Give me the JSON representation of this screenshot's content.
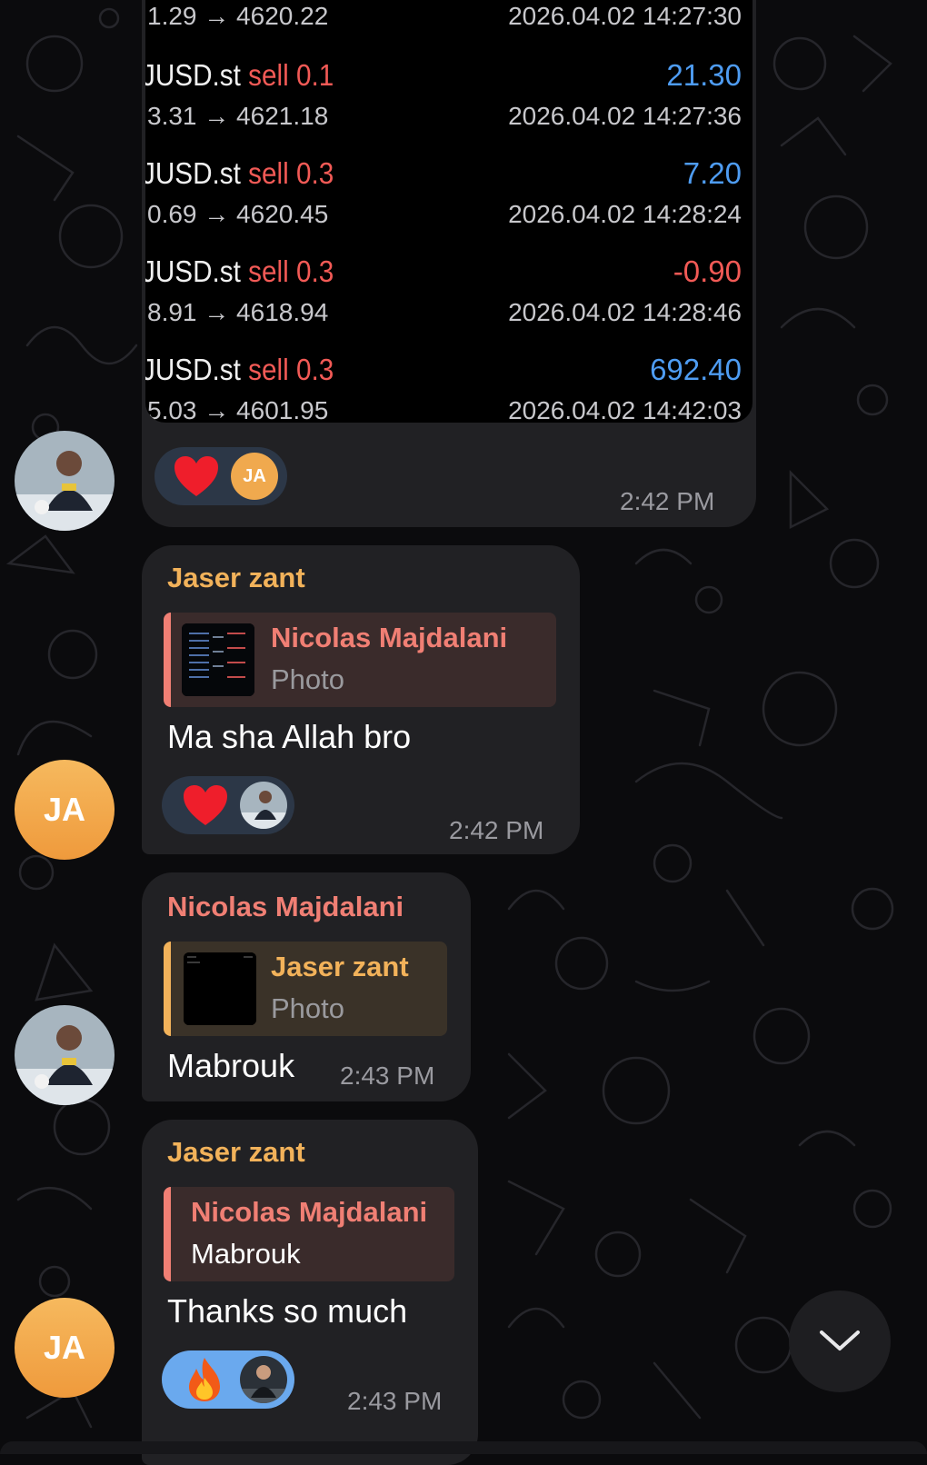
{
  "colors": {
    "profit_positive": "#4e9cf2",
    "profit_negative": "#f25a56",
    "sender_jaser": "#f2b25a",
    "sender_nicolas": "#f07f74",
    "bubble": "#212124",
    "background": "#0b0b0d"
  },
  "trade_screenshot": {
    "first_row": {
      "prices": "1.29 → 4620.22",
      "date": "2026.04.02 14:27:30"
    },
    "rows": [
      {
        "symbol": "JUSD.st",
        "side": "sell 0.1",
        "profit": "21.30",
        "prices": "3.31 → 4621.18",
        "date": "2026.04.02 14:27:36",
        "profit_color": "#4e9cf2"
      },
      {
        "symbol": "JUSD.st",
        "side": "sell 0.3",
        "profit": "7.20",
        "prices": "0.69 → 4620.45",
        "date": "2026.04.02 14:28:24",
        "profit_color": "#4e9cf2"
      },
      {
        "symbol": "JUSD.st",
        "side": "sell 0.3",
        "profit": "-0.90",
        "prices": "8.91 → 4618.94",
        "date": "2026.04.02 14:28:46",
        "profit_color": "#f25a56"
      },
      {
        "symbol": "JUSD.st",
        "side": "sell 0.3",
        "profit": "692.40",
        "prices": "5.03 → 4601.95",
        "date": "2026.04.02 14:42:03",
        "profit_color": "#4e9cf2"
      }
    ]
  },
  "messages": [
    {
      "sender": "",
      "time": "2:42 PM",
      "reaction": {
        "emoji": "heart",
        "reactor_initials": "JA"
      }
    },
    {
      "sender": "Jaser zant",
      "reply": {
        "name": "Nicolas Majdalani",
        "text": "Photo"
      },
      "text": "Ma sha Allah bro",
      "time": "2:42 PM",
      "reaction": {
        "emoji": "heart",
        "reactor_icon": "user-photo-icon"
      },
      "avatar_initials": "JA"
    },
    {
      "sender": "Nicolas Majdalani",
      "reply": {
        "name": "Jaser zant",
        "text": "Photo"
      },
      "text": "Mabrouk",
      "time": "2:43 PM"
    },
    {
      "sender": "Jaser zant",
      "reply": {
        "name": "Nicolas Majdalani",
        "text": "Mabrouk"
      },
      "text": "Thanks so much",
      "time": "2:43 PM",
      "reaction": {
        "emoji": "fire",
        "reactor_icon": "user-photo-icon"
      },
      "avatar_initials": "JA"
    }
  ],
  "scroll_button_icon": "chevron-down-icon"
}
